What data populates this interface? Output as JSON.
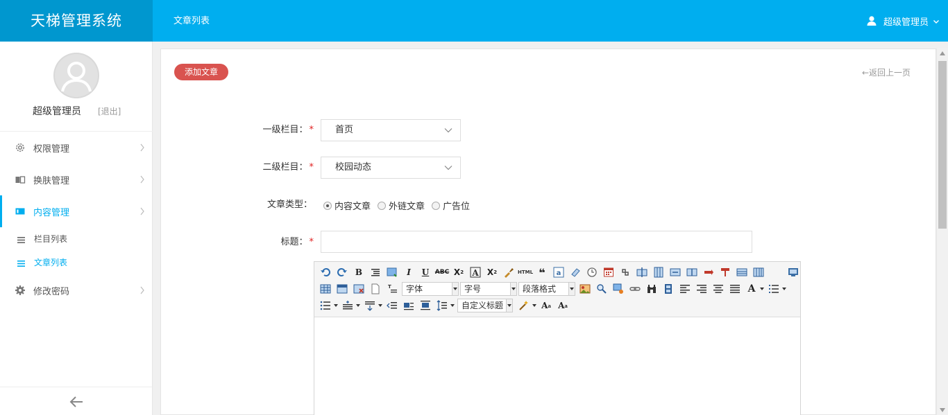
{
  "app": {
    "title": "天梯管理系统"
  },
  "header": {
    "breadcrumb": "文章列表",
    "user_name": "超级管理员"
  },
  "profile": {
    "name": "超级管理员",
    "logout": "[退出]"
  },
  "sidebar": {
    "items": [
      {
        "label": "权限管理",
        "icon": "gear-icon"
      },
      {
        "label": "换肤管理",
        "icon": "book-icon"
      },
      {
        "label": "内容管理",
        "icon": "folder-icon",
        "active": true
      },
      {
        "label": "修改密码",
        "icon": "cog-icon"
      }
    ],
    "sub_items": [
      {
        "label": "栏目列表"
      },
      {
        "label": "文章列表",
        "active": true
      }
    ]
  },
  "panel": {
    "add_button": "添加文章",
    "back_link": "←返回上一页"
  },
  "form": {
    "category1": {
      "label": "一级栏目：",
      "value": "首页"
    },
    "category2": {
      "label": "二级栏目：",
      "value": "校园动态"
    },
    "article_type": {
      "label": "文章类型：",
      "options": [
        "内容文章",
        "外链文章",
        "广告位"
      ],
      "selected": 0
    },
    "title": {
      "label": "标题：",
      "value": ""
    }
  },
  "editor": {
    "font_family": "字体",
    "font_size": "字号",
    "paragraph": "段落格式",
    "custom_title": "自定义标题",
    "html_label": "HTML"
  },
  "colors": {
    "accent": "#00aeef",
    "brand_bg": "#0097cf",
    "danger": "#d9534f"
  }
}
